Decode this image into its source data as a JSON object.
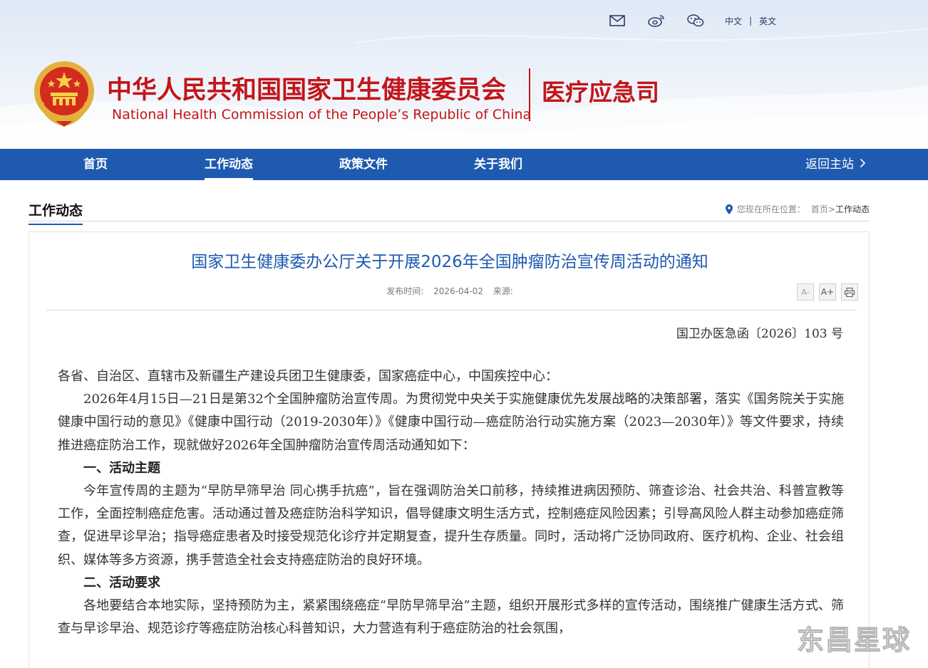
{
  "header": {
    "title_cn": "中华人民共和国国家卫生健康委员会",
    "title_en": "National Health Commission of the People’s  Republic of China",
    "department": "医疗应急司",
    "lang_cn": "中文",
    "lang_sep": "|",
    "lang_en": "英文",
    "icons": [
      "mail-icon",
      "weibo-icon",
      "wechat-icon"
    ]
  },
  "nav": {
    "items": [
      {
        "label": "首页"
      },
      {
        "label": "工作动态"
      },
      {
        "label": "政策文件"
      },
      {
        "label": "关于我们"
      }
    ],
    "active_index": 1,
    "back_label": "返回主站"
  },
  "section": {
    "title": "工作动态",
    "breadcrumb_prefix": "您现在所在位置：",
    "breadcrumb_home": "首页",
    "breadcrumb_sep": ">",
    "breadcrumb_current": "工作动态"
  },
  "article": {
    "title": "国家卫生健康委办公厅关于开展2026年全国肿瘤防治宣传周活动的通知",
    "date_label": "发布时间:",
    "date": "2026-04-02",
    "source_label": "来源:",
    "font_small": "A-",
    "font_large": "A+",
    "doc_number": "国卫办医急函〔2026〕103 号",
    "salutation": "各省、自治区、直辖市及新疆生产建设兵团卫生健康委，国家癌症中心，中国疾控中心：",
    "para1": "2026年4月15日—21日是第32个全国肿瘤防治宣传周。为贯彻党中央关于实施健康优先发展战略的决策部署，落实《国务院关于实施健康中国行动的意见》《健康中国行动（2019-2030年）》《健康中国行动—癌症防治行动实施方案（2023—2030年）》等文件要求，持续推进癌症防治工作，现就做好2026年全国肿瘤防治宣传周活动通知如下：",
    "heading1": "一、活动主题",
    "para2": "今年宣传周的主题为“早防早筛早治 同心携手抗癌”，旨在强调防治关口前移，持续推进病因预防、筛查诊治、社会共治、科普宣教等工作，全面控制癌症危害。活动通过普及癌症防治科学知识，倡导健康文明生活方式，控制癌症风险因素；引导高风险人群主动参加癌症筛查，促进早诊早治；指导癌症患者及时接受规范化诊疗并定期复查，提升生存质量。同时，活动将广泛协同政府、医疗机构、企业、社会组织、媒体等多方资源，携手营造全社会支持癌症防治的良好环境。",
    "heading2": "二、活动要求",
    "para3": "各地要结合本地实际，坚持预防为主，紧紧围绕癌症“早防早筛早治”主题，组织开展形式多样的宣传活动，围绕推广健康生活方式、筛查与早诊早治、规范诊疗等癌症防治核心科普知识，大力营造有利于癌症防治的社会氛围，"
  },
  "watermark": "东昌星球",
  "colors": {
    "brand_red": "#c2151a",
    "nav_blue": "#1e5ab0",
    "title_blue": "#1e5ab0"
  }
}
